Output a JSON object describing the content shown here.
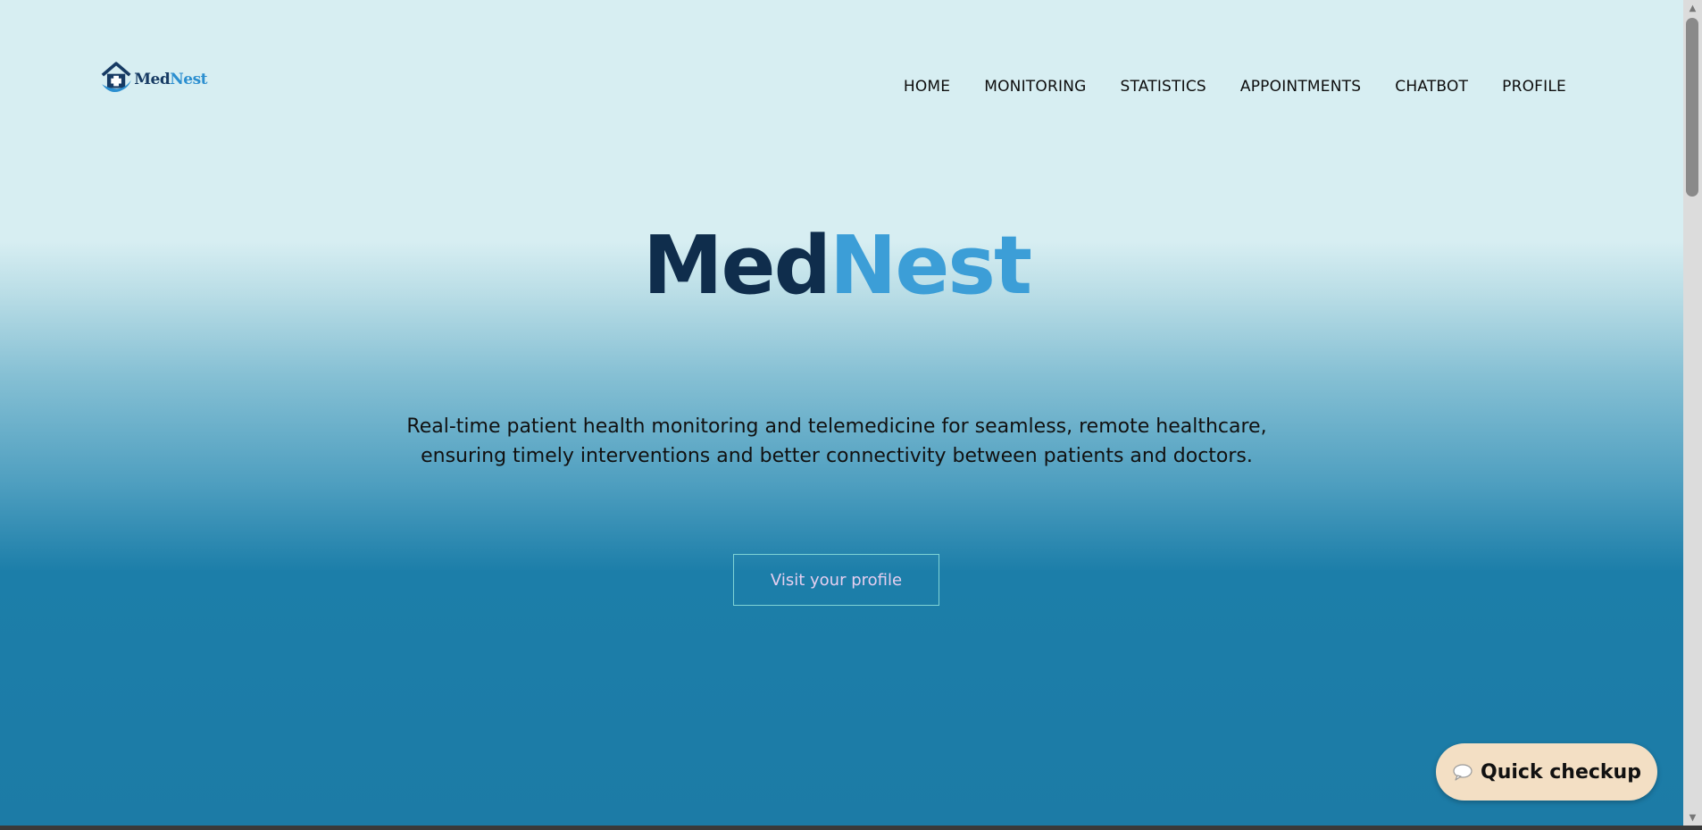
{
  "brand": {
    "logo_part1": "Med",
    "logo_part2": "Nest"
  },
  "nav": {
    "items": [
      {
        "label": "HOME"
      },
      {
        "label": "MONITORING"
      },
      {
        "label": "STATISTICS"
      },
      {
        "label": "APPOINTMENTS"
      },
      {
        "label": "CHATBOT"
      },
      {
        "label": "PROFILE"
      }
    ]
  },
  "hero": {
    "title_part1": "Med",
    "title_part2": "Nest",
    "tagline_line1": "Real-time patient health monitoring and telemedicine for seamless, remote healthcare,",
    "tagline_line2": "ensuring timely interventions and better connectivity between patients and doctors.",
    "cta_label": "Visit your profile"
  },
  "quick_checkup": {
    "label": "Quick checkup",
    "icon": "chat-bubble-icon"
  },
  "colors": {
    "brand_dark": "#0f2d4c",
    "brand_light": "#3c9ed7",
    "quick_checkup_bg": "#f3dfc4",
    "cta_border": "#7fd3d5"
  },
  "scrollbar": {
    "up_icon": "▲",
    "down_icon": "▼"
  }
}
